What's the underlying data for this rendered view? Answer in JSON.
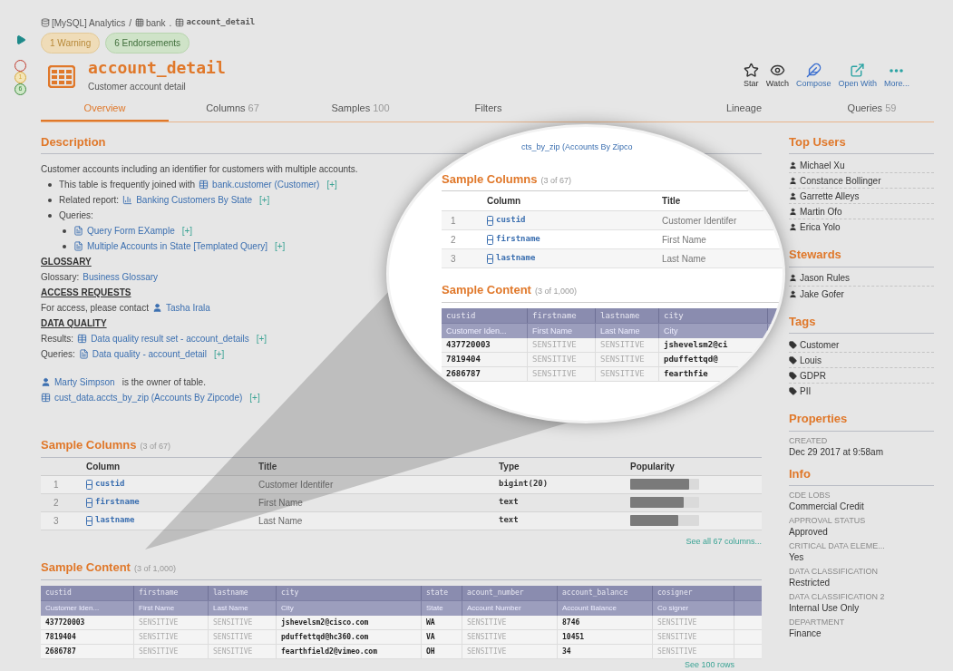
{
  "gutter": [
    {
      "kind": "empty"
    },
    {
      "kind": "warning",
      "label": "1"
    },
    {
      "kind": "endorsement",
      "label": "6"
    }
  ],
  "breadcrumb": [
    {
      "kind": "database",
      "label": "[MySQL] Analytics"
    },
    {
      "kind": "separator",
      "label": "/"
    },
    {
      "kind": "schema",
      "label": "bank"
    },
    {
      "kind": "separator",
      "label": "."
    },
    {
      "kind": "table",
      "label": "account_detail"
    }
  ],
  "badges": [
    {
      "kind": "warning",
      "label": "1 Warning"
    },
    {
      "kind": "endorsement",
      "label": "6 Endorsements"
    }
  ],
  "title": "account_detail",
  "subtitle": "Customer account detail",
  "actions": [
    {
      "kind": "star",
      "label": "Star"
    },
    {
      "kind": "watch",
      "label": "Watch"
    },
    {
      "kind": "compose",
      "label": "Compose"
    },
    {
      "kind": "open",
      "label": "Open With"
    },
    {
      "kind": "more",
      "label": "More..."
    }
  ],
  "tabs": [
    {
      "label": "Overview",
      "selected": true
    },
    {
      "label": "Columns",
      "count": "67",
      "selected": false
    },
    {
      "label": "Samples",
      "count": "100",
      "selected": false
    },
    {
      "label": "Filters",
      "selected": false
    },
    {
      "label": "Lineage",
      "selected": false
    },
    {
      "label": "Queries",
      "count": "59",
      "selected": false
    }
  ],
  "description": {
    "title": "Description",
    "intro": "Customer accounts including an identifier for customers with multiple accounts.",
    "bullets": [
      {
        "prefix": "This table is frequently joined with",
        "kind": "table",
        "link": "bank.customer (Customer)",
        "plus": "[+]"
      },
      {
        "prefix": "Related report:",
        "kind": "chart",
        "link": "Banking Customers By State",
        "plus": "[+]"
      },
      {
        "prefix": "Queries:",
        "children": [
          {
            "kind": "query",
            "link": "Query Form EXample",
            "plus": "[+]"
          },
          {
            "kind": "query",
            "link": "Multiple Accounts in State [Templated Query]",
            "plus": "[+]"
          }
        ]
      }
    ],
    "sections": [
      {
        "heading": "GLOSSARY",
        "lines": [
          {
            "prefix": "Glossary:",
            "link": "Business Glossary"
          }
        ]
      },
      {
        "heading": "ACCESS REQUESTS",
        "lines": [
          {
            "prefix": "For access, please contact",
            "kind": "user",
            "link": "Tasha Irala"
          }
        ]
      },
      {
        "heading": "DATA QUALITY",
        "lines": [
          {
            "prefix": "Results:",
            "kind": "resultset",
            "link": "Data quality result set - account_details",
            "plus": "[+]"
          },
          {
            "prefix": "Queries:",
            "kind": "query",
            "link": "Data quality - account_detail",
            "plus": "[+]"
          }
        ]
      }
    ],
    "footer": [
      {
        "kind": "user",
        "link": "Marty Simpson",
        "suffix": "is the owner of table."
      },
      {
        "kind": "table",
        "link": "cust_data.accts_by_zip (Accounts By Zipcode)",
        "plus": "[+]"
      }
    ]
  },
  "sample_columns": {
    "title": "Sample Columns",
    "count": "(3 of 67)",
    "columns": [
      "Column",
      "Title",
      "Type",
      "Popularity"
    ],
    "rows": [
      {
        "index": "1",
        "column": "custid",
        "title": "Customer Identifer",
        "type": "bigint(20)",
        "level": 0.86
      },
      {
        "index": "2",
        "column": "firstname",
        "title": "First Name",
        "type": "text",
        "level": 0.77
      },
      {
        "index": "3",
        "column": "lastname",
        "title": "Last Name",
        "type": "text",
        "level": 0.7
      }
    ],
    "more": "See all 67 columns..."
  },
  "sample_content": {
    "title": "Sample Content",
    "count": "(3 of 1,000)",
    "columns": [
      {
        "name": "custid",
        "title": "Customer Iden...",
        "masked": false
      },
      {
        "name": "firstname",
        "title": "First Name",
        "masked": true
      },
      {
        "name": "lastname",
        "title": "Last Name",
        "masked": true
      },
      {
        "name": "city",
        "title": "City",
        "masked": false
      },
      {
        "name": "state",
        "title": "State",
        "masked": false
      },
      {
        "name": "acount_number",
        "title": "Account Number",
        "masked": true
      },
      {
        "name": "account_balance",
        "title": "Account Balance",
        "masked": false
      },
      {
        "name": "cosigner",
        "title": "Co signer",
        "masked": true
      }
    ],
    "rows": [
      [
        "437720003",
        "SENSITIVE",
        "SENSITIVE",
        "jshevelsm2@cisco.com",
        "WA",
        "SENSITIVE",
        "8746",
        "SENSITIVE"
      ],
      [
        "7819404",
        "SENSITIVE",
        "SENSITIVE",
        "pduffettqd@hc360.com",
        "VA",
        "SENSITIVE",
        "10451",
        "SENSITIVE"
      ],
      [
        "2686787",
        "SENSITIVE",
        "SENSITIVE",
        "fearthfield2@vimeo.com",
        "OH",
        "SENSITIVE",
        "34",
        "SENSITIVE"
      ]
    ],
    "more": "See 100 rows"
  },
  "magnifier": {
    "top_link": "cts_by_zip (Accounts By Zipco",
    "columns_title": "Sample Columns",
    "columns_count": "(3 of 67)",
    "column_headers": [
      "Column",
      "Title"
    ],
    "column_rows": [
      {
        "index": "1",
        "column": "custid",
        "title": "Customer Identifer"
      },
      {
        "index": "2",
        "column": "firstname",
        "title": "First Name"
      },
      {
        "index": "3",
        "column": "lastname",
        "title": "Last Name"
      }
    ],
    "content_title": "Sample Content",
    "content_count": "(3 of 1,000)",
    "content_columns": [
      {
        "name": "custid",
        "title": "Customer Iden...",
        "masked": false
      },
      {
        "name": "firstname",
        "title": "First Name",
        "masked": true
      },
      {
        "name": "lastname",
        "title": "Last Name",
        "masked": true
      },
      {
        "name": "city",
        "title": "City",
        "masked": false
      }
    ],
    "content_rows": [
      [
        "437720003",
        "SENSITIVE",
        "SENSITIVE",
        "jshevelsm2@ci"
      ],
      [
        "7819404",
        "SENSITIVE",
        "SENSITIVE",
        "pduffettqd@"
      ],
      [
        "2686787",
        "SENSITIVE",
        "SENSITIVE",
        "fearthfie"
      ]
    ]
  },
  "sidebar": {
    "top_users": {
      "title": "Top Users",
      "items": [
        "Michael Xu",
        "Constance Bollinger",
        "Garrette Alleys",
        "Martin Ofo",
        "Erica Yolo"
      ]
    },
    "stewards": {
      "title": "Stewards",
      "items": [
        "Jason Rules",
        "Jake Gofer"
      ]
    },
    "tags": {
      "title": "Tags",
      "items": [
        "Customer",
        "Louis",
        "GDPR",
        "PII"
      ]
    },
    "properties": {
      "title": "Properties",
      "items": [
        {
          "label": "CREATED",
          "value": "Dec 29 2017 at 9:58am"
        }
      ]
    },
    "info": {
      "title": "Info",
      "items": [
        {
          "label": "CDE LOBS",
          "value": "Commercial Credit"
        },
        {
          "label": "APPROVAL STATUS",
          "value": "Approved"
        },
        {
          "label": "CRITICAL DATA ELEME...",
          "value": "Yes"
        },
        {
          "label": "DATA CLASSIFICATION",
          "value": "Restricted"
        },
        {
          "label": "DATA CLASSIFICATION 2",
          "value": "Internal Use Only"
        },
        {
          "label": "DEPARTMENT",
          "value": "Finance"
        }
      ]
    }
  }
}
